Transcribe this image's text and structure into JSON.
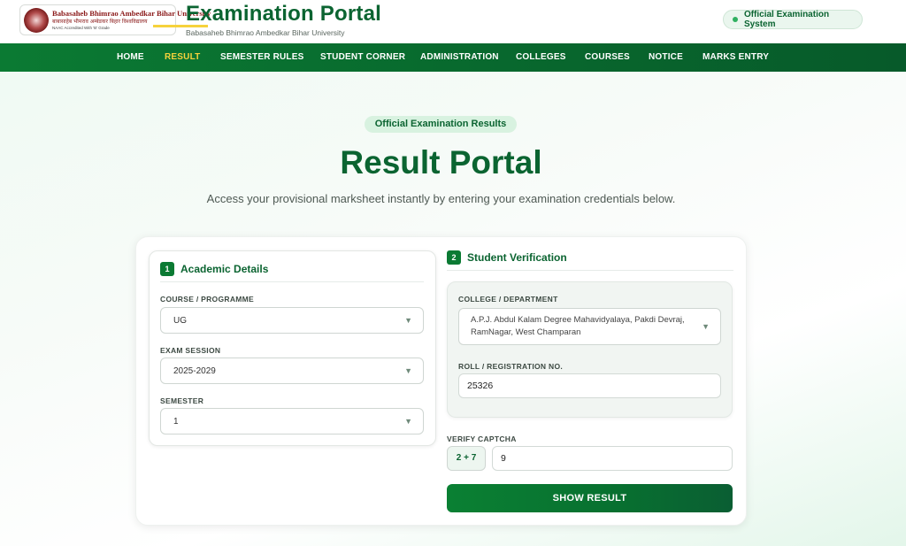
{
  "header": {
    "logo": {
      "name_en": "Babasaheb Bhimrao Ambedkar Bihar University",
      "name_hi": "बाबासाहेब भीमराव अम्बेडकर बिहार विश्वविद्यालय",
      "accreditation": "NAAC Accredited With 'B' Grade"
    },
    "title": "Examination Portal",
    "subtitle": "Babasaheb Bhimrao Ambedkar Bihar University",
    "status_pill": "Official Examination System"
  },
  "nav": {
    "items": [
      {
        "label": "HOME"
      },
      {
        "label": "RESULT",
        "active": true
      },
      {
        "label": "SEMESTER RULES"
      },
      {
        "label": "STUDENT CORNER"
      },
      {
        "label": "ADMINISTRATION"
      },
      {
        "label": "COLLEGES"
      },
      {
        "label": "COURSES"
      },
      {
        "label": "NOTICE"
      },
      {
        "label": "MARKS ENTRY"
      }
    ]
  },
  "hero": {
    "badge": "Official Examination Results",
    "title": "Result Portal",
    "description": "Access your provisional marksheet instantly by entering your examination credentials below."
  },
  "form": {
    "academic": {
      "step": "1",
      "heading": "Academic Details",
      "course_label": "COURSE / PROGRAMME",
      "course_value": "UG",
      "session_label": "EXAM SESSION",
      "session_value": "2025-2029",
      "semester_label": "SEMESTER",
      "semester_value": "1"
    },
    "verification": {
      "step": "2",
      "heading": "Student Verification",
      "college_label": "COLLEGE / DEPARTMENT",
      "college_value_line1": "A.P.J. Abdul Kalam Degree Mahavidyalaya, Pakdi Devraj,",
      "college_value_line2": "RamNagar, West Champaran",
      "roll_label": "ROLL / REGISTRATION NO.",
      "roll_value": "25326",
      "captcha_label": "VERIFY CAPTCHA",
      "captcha_question": "2 + 7",
      "captcha_answer": "9"
    },
    "submit_label": "SHOW RESULT"
  },
  "colors": {
    "brand_green": "#0b6431",
    "nav_green": "#0b7a33",
    "active_yellow": "#f6d23c"
  },
  "icons": {
    "dropdown": "caret-down-icon",
    "status": "status-dot-icon"
  }
}
